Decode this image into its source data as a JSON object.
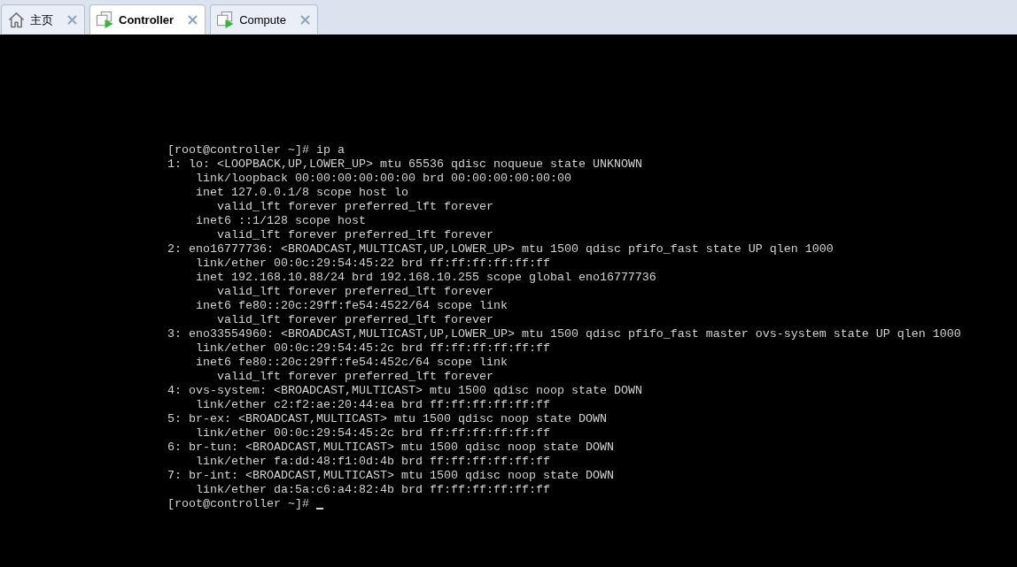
{
  "tabs": [
    {
      "label": "主页",
      "kind": "home",
      "selected": false
    },
    {
      "label": "Controller",
      "kind": "vm",
      "selected": true
    },
    {
      "label": "Compute",
      "kind": "vm",
      "selected": false
    }
  ],
  "terminal": {
    "cursor": true,
    "lines": [
      {
        "text": "[root@controller ~]# ip a"
      },
      {
        "text": "1: lo: <LOOPBACK,UP,LOWER_UP> mtu 65536 qdisc noqueue state UNKNOWN",
        "children": [
          {
            "text": "link/loopback 00:00:00:00:00:00 brd 00:00:00:00:00:00"
          },
          {
            "text": "inet 127.0.0.1/8 scope host lo",
            "children": [
              {
                "text": "valid_lft forever preferred_lft forever"
              }
            ]
          },
          {
            "text": "inet6 ::1/128 scope host",
            "children": [
              {
                "text": "valid_lft forever preferred_lft forever"
              }
            ]
          }
        ]
      },
      {
        "text": "2: eno16777736: <BROADCAST,MULTICAST,UP,LOWER_UP> mtu 1500 qdisc pfifo_fast state UP qlen 1000",
        "children": [
          {
            "text": "link/ether 00:0c:29:54:45:22 brd ff:ff:ff:ff:ff:ff"
          },
          {
            "text": "inet 192.168.10.88/24 brd 192.168.10.255 scope global eno16777736",
            "children": [
              {
                "text": "valid_lft forever preferred_lft forever"
              }
            ]
          },
          {
            "text": "inet6 fe80::20c:29ff:fe54:4522/64 scope link",
            "children": [
              {
                "text": "valid_lft forever preferred_lft forever"
              }
            ]
          }
        ]
      },
      {
        "text": "3: eno33554960: <BROADCAST,MULTICAST,UP,LOWER_UP> mtu 1500 qdisc pfifo_fast master ovs-system state UP qlen 1000",
        "children": [
          {
            "text": "link/ether 00:0c:29:54:45:2c brd ff:ff:ff:ff:ff:ff"
          },
          {
            "text": "inet6 fe80::20c:29ff:fe54:452c/64 scope link",
            "children": [
              {
                "text": "valid_lft forever preferred_lft forever"
              }
            ]
          }
        ]
      },
      {
        "text": "4: ovs-system: <BROADCAST,MULTICAST> mtu 1500 qdisc noop state DOWN",
        "children": [
          {
            "text": "link/ether c2:f2:ae:20:44:ea brd ff:ff:ff:ff:ff:ff"
          }
        ]
      },
      {
        "text": "5: br-ex: <BROADCAST,MULTICAST> mtu 1500 qdisc noop state DOWN",
        "children": [
          {
            "text": "link/ether 00:0c:29:54:45:2c brd ff:ff:ff:ff:ff:ff"
          }
        ]
      },
      {
        "text": "6: br-tun: <BROADCAST,MULTICAST> mtu 1500 qdisc noop state DOWN",
        "children": [
          {
            "text": "link/ether fa:dd:48:f1:0d:4b brd ff:ff:ff:ff:ff:ff"
          }
        ]
      },
      {
        "text": "7: br-int: <BROADCAST,MULTICAST> mtu 1500 qdisc noop state DOWN",
        "children": [
          {
            "text": "link/ether da:5a:c6:a4:82:4b brd ff:ff:ff:ff:ff:ff"
          }
        ]
      },
      {
        "text": "[root@controller ~]#"
      }
    ]
  }
}
